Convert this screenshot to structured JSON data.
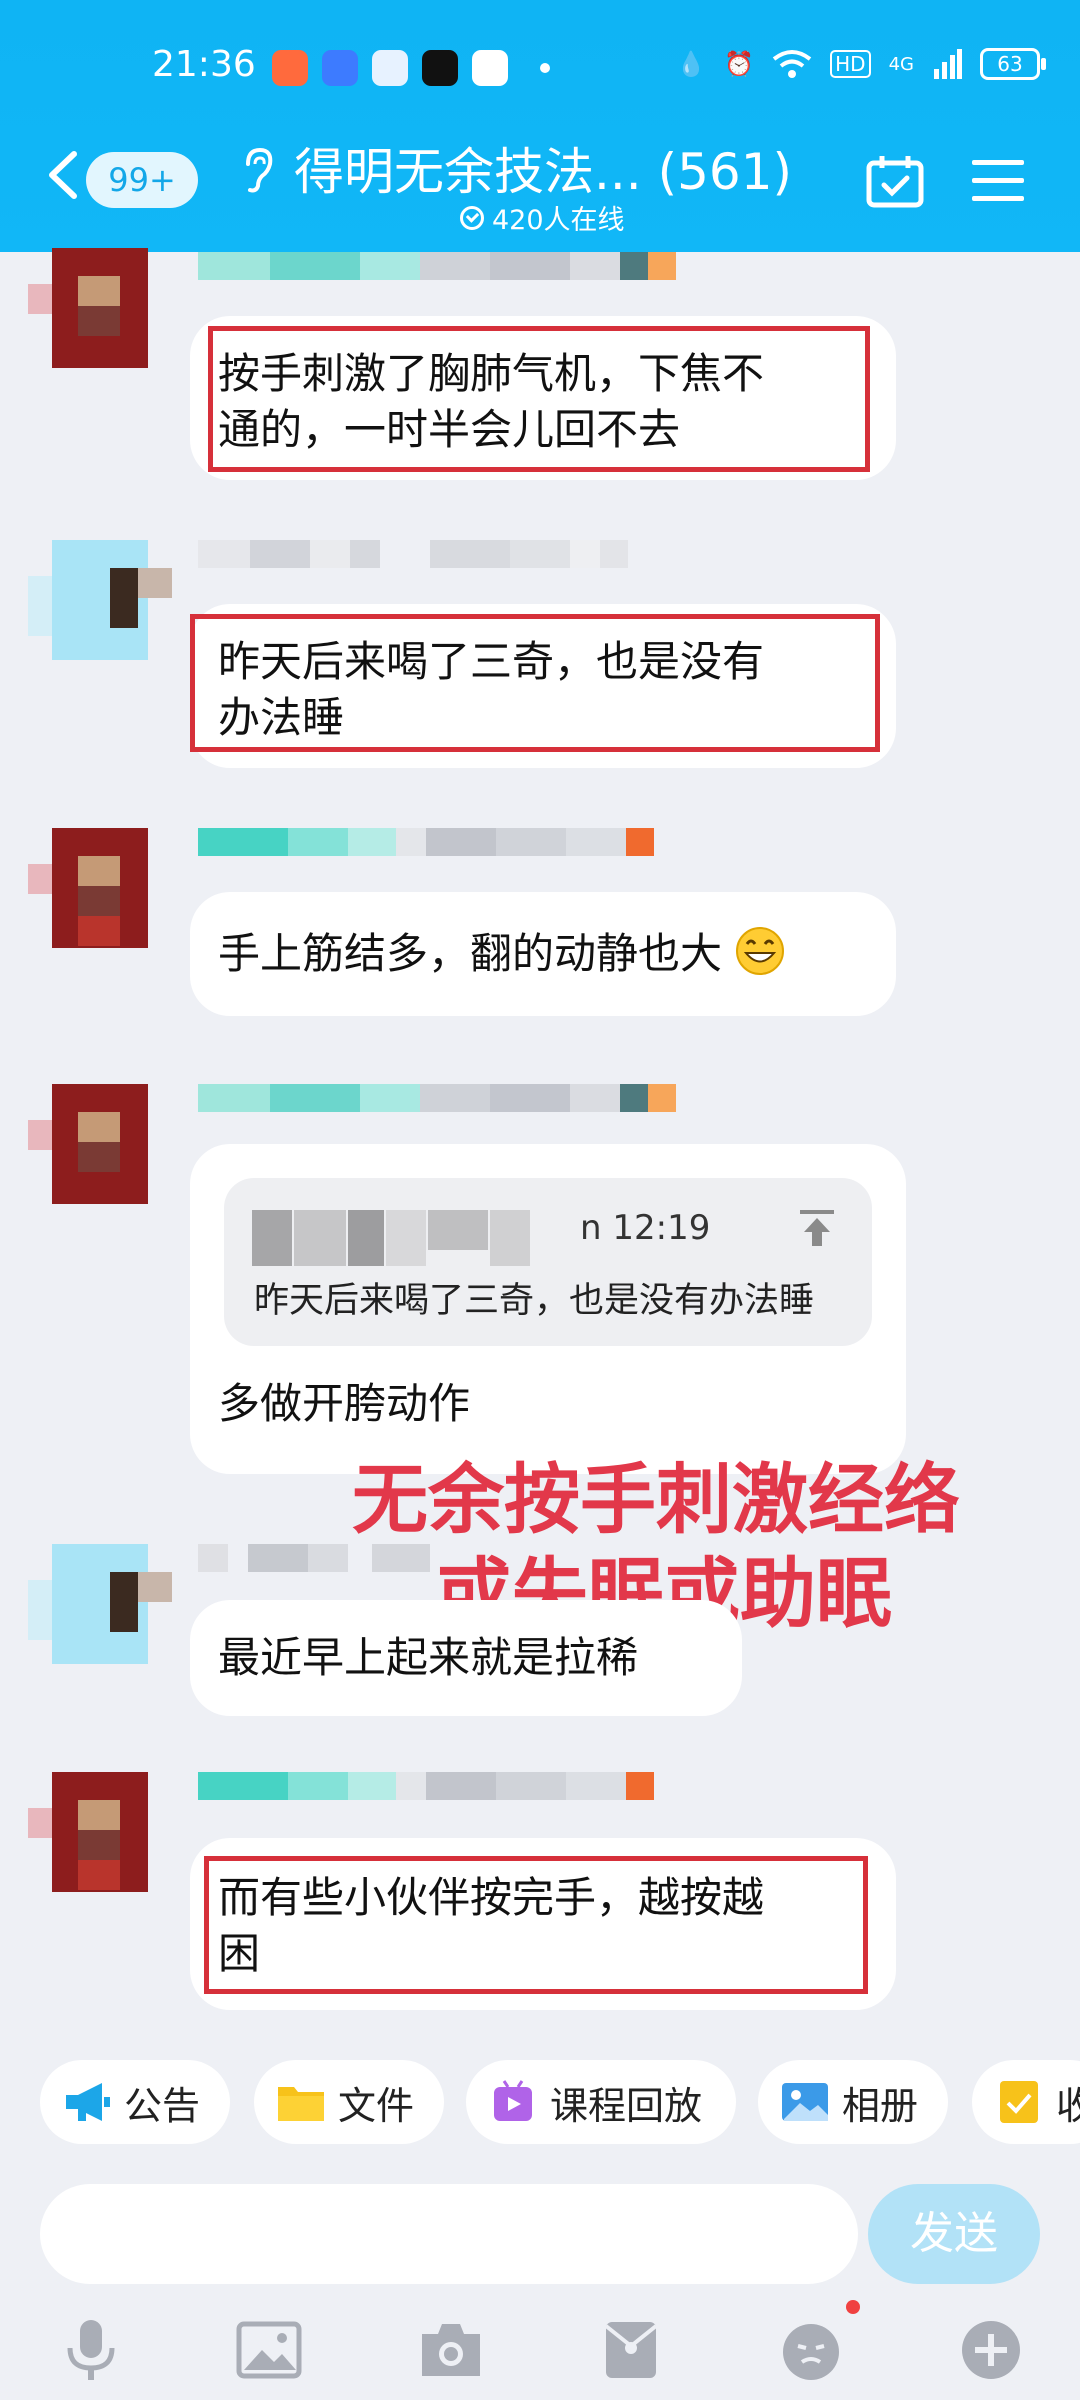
{
  "status_bar": {
    "time": "21:36",
    "network": "4G",
    "hd": "HD",
    "battery": "63"
  },
  "header": {
    "unread_count": "99+",
    "group_name": "得明无余技法... (561)",
    "online_text": "420人在线"
  },
  "messages": [
    {
      "text_lines": [
        "按手刺激了胸肺气机，下焦不",
        "通的，一时半会儿回不去"
      ],
      "highlighted": true
    },
    {
      "text_lines": [
        "昨天后来喝了三奇，也是没有",
        "办法睡"
      ],
      "highlighted": true
    },
    {
      "text_lines": [
        "手上筋结多，翻的动静也大"
      ],
      "emoji": "grin-emoji",
      "highlighted": false
    },
    {
      "quote": {
        "time_fragment": "n 12:19",
        "text": "昨天后来喝了三奇，也是没有办法睡"
      },
      "text_lines": [
        "多做开胯动作"
      ],
      "highlighted": false
    },
    {
      "text_lines": [
        "最近早上起来就是拉稀"
      ],
      "highlighted": false
    },
    {
      "text_lines": [
        "而有些小伙伴按完手，越按越",
        "困"
      ],
      "highlighted": true
    }
  ],
  "overlay_annotation": {
    "line1": "无余按手刺激经络",
    "line2": "或失眠或助眠",
    "color": "#e2384a"
  },
  "shortcuts": [
    {
      "label": "公告",
      "icon": "megaphone-icon"
    },
    {
      "label": "文件",
      "icon": "folder-icon"
    },
    {
      "label": "课程回放",
      "icon": "course-replay-icon"
    },
    {
      "label": "相册",
      "icon": "album-icon"
    },
    {
      "label": "收",
      "icon": "collection-icon"
    }
  ],
  "composer": {
    "input_value": "",
    "send_label": "发送"
  },
  "toolbar_icons": [
    "microphone-icon",
    "image-icon",
    "camera-icon",
    "red-packet-icon",
    "emoji-icon",
    "plus-icon"
  ],
  "colors": {
    "header_blue": "#11b7f7",
    "highlight_red": "#d6303a",
    "send_button": "#b2e2f7"
  }
}
